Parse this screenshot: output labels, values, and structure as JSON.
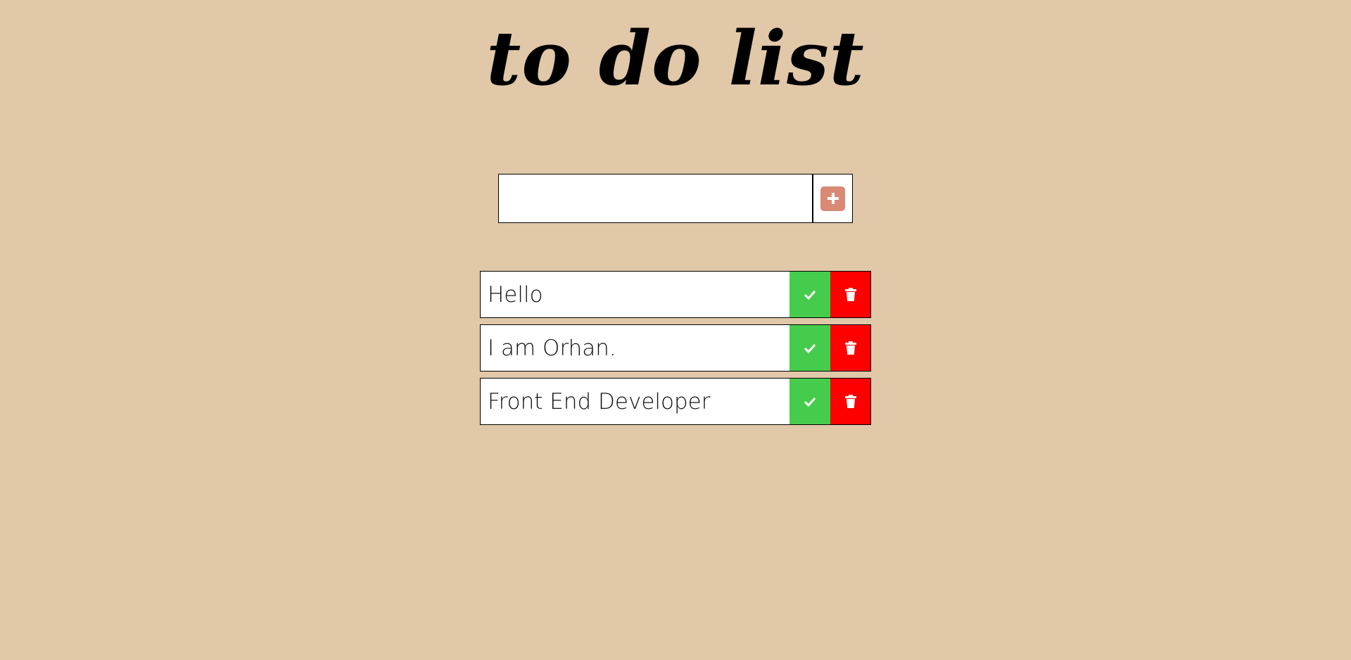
{
  "app": {
    "title": "to do list"
  },
  "add_form": {
    "input_value": "",
    "add_icon": "plus-square-icon",
    "add_color": "#d98a74"
  },
  "todos": [
    {
      "text": "Hello"
    },
    {
      "text": "I am Orhan."
    },
    {
      "text": "Front End Developer"
    }
  ],
  "icons": {
    "complete": "check-icon",
    "delete": "trash-icon"
  },
  "colors": {
    "background": "#e0c8a8",
    "complete": "#46cc4c",
    "delete": "#ff0000"
  }
}
